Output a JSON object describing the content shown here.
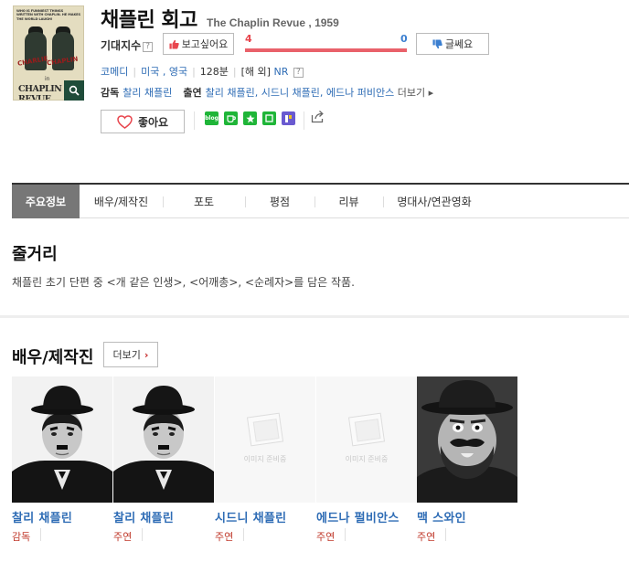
{
  "movie": {
    "title": "채플린 회고",
    "original_title": "The Chaplin Revue , 1959",
    "poster_top_text": "WHO IS FUNNIEST THINGS WRITTEN WITH CHAPLIN. HE MAKES THE WORLD LAUGH!",
    "poster_title_text": "CHAPLIN REVUE"
  },
  "expectation": {
    "label": "기대지수",
    "help_icon": "?",
    "want_label": "보고싶어요",
    "skip_label": "글쎄요",
    "want_count": "4",
    "skip_count": "0",
    "want_fraction": 1.0,
    "want_color": "#e9616a",
    "skip_color": "#4f8fd6"
  },
  "meta": {
    "genre": "코메디",
    "country": "미국 , 영국",
    "runtime": "128분",
    "rating_prefix": "[해 외]",
    "rating": "NR",
    "help_icon": "?"
  },
  "credits": {
    "director_label": "감독",
    "director": "찰리 채플린",
    "cast_label": "출연",
    "cast": "찰리 채플린, 시드니 채플린, 에드나 퍼비안스",
    "more_label": "더보기"
  },
  "actions": {
    "like_label": "좋아요",
    "share_blog": "blog",
    "share_icons": [
      "blog-share-icon",
      "cafe-share-icon",
      "bookmark-share-icon",
      "memo-share-icon",
      "post-share-icon",
      "share-icon"
    ]
  },
  "tabs": [
    {
      "label": "주요정보",
      "active": true
    },
    {
      "label": "배우/제작진",
      "active": false
    },
    {
      "label": "포토",
      "active": false
    },
    {
      "label": "평점",
      "active": false
    },
    {
      "label": "리뷰",
      "active": false
    },
    {
      "label": "명대사/연관영화",
      "active": false
    }
  ],
  "synopsis": {
    "heading": "줄거리",
    "text": "채플린 초기 단편 중 <개 같은 인생>, <어깨총>, <순례자>를 담은 작품."
  },
  "cast_section": {
    "heading": "배우/제작진",
    "more_label": "더보기",
    "placeholder_text": "이미지 준비중",
    "people": [
      {
        "name": "찰리 채플린",
        "role": "감독",
        "photo": "chaplin"
      },
      {
        "name": "찰리 채플린",
        "role": "주연",
        "photo": "chaplin"
      },
      {
        "name": "시드니 채플린",
        "role": "주연",
        "photo": "placeholder"
      },
      {
        "name": "에드나 펄비안스",
        "role": "주연",
        "photo": "placeholder"
      },
      {
        "name": "맥 스와인",
        "role": "주연",
        "photo": "swain"
      }
    ]
  }
}
